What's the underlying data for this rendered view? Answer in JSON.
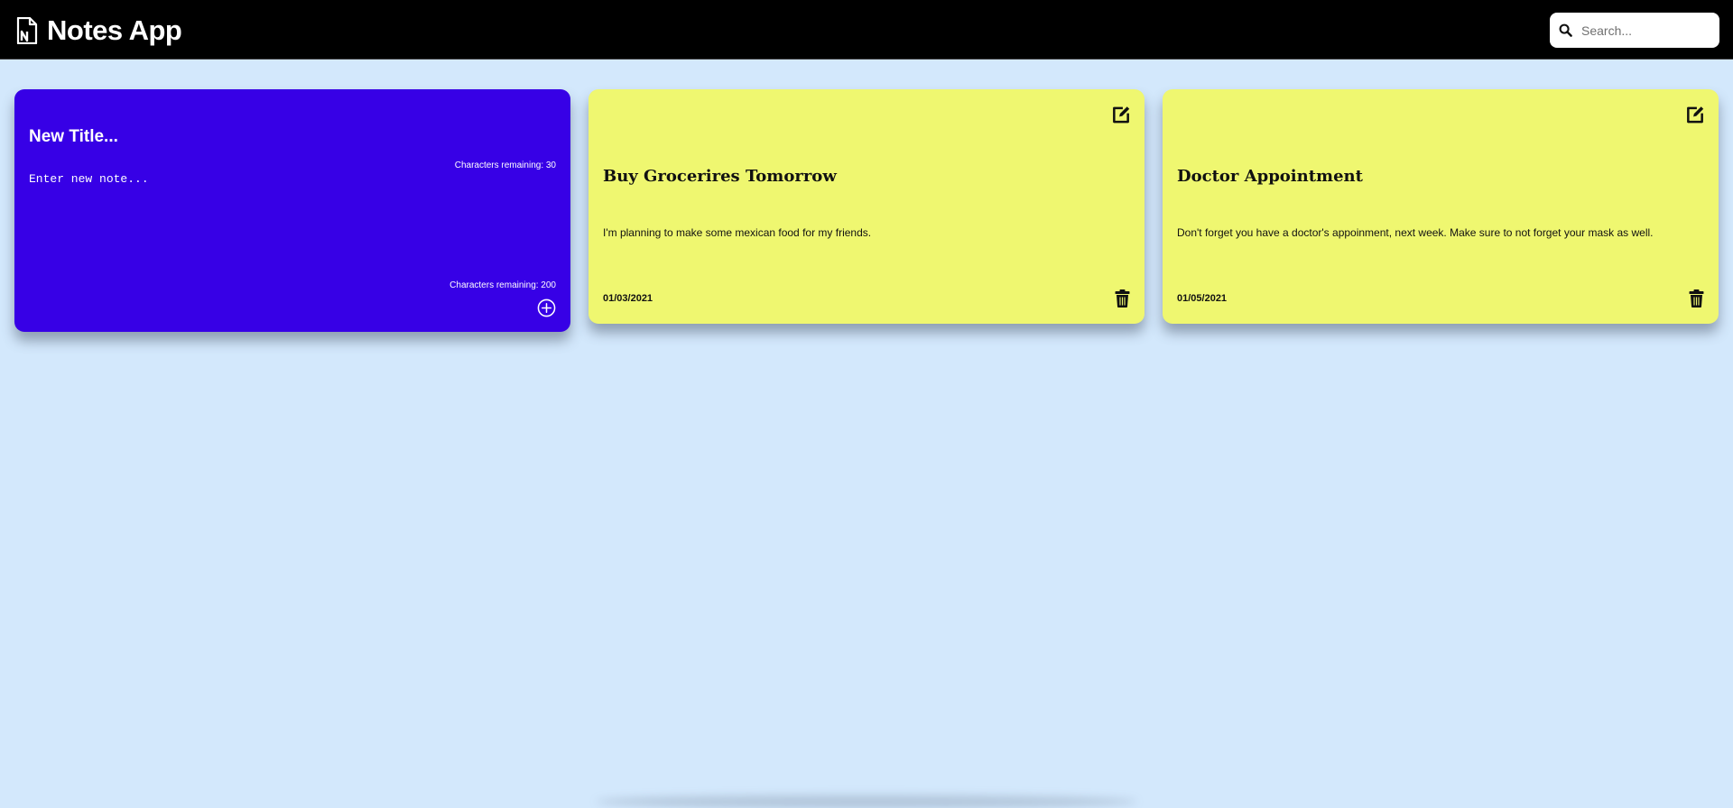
{
  "header": {
    "app_title": "Notes App",
    "logo_icon": "note-document-icon",
    "search": {
      "placeholder": "Search...",
      "value": "",
      "icon": "search-icon"
    }
  },
  "new_note": {
    "title_placeholder": "New Title...",
    "title_chars_remaining": "Characters remaining: 30",
    "body_placeholder": "Enter new note...",
    "body_chars_remaining": "Characters remaining: 200",
    "add_icon": "plus-circle-icon",
    "color": "#3700e6"
  },
  "notes": [
    {
      "title": "Buy Grocerires Tomorrow",
      "text": "I'm planning to make some mexican food for my friends.",
      "date": "01/03/2021",
      "edit_icon": "edit-icon",
      "delete_icon": "trash-icon",
      "color": "#eff770"
    },
    {
      "title": "Doctor Appointment",
      "text": "Don't forget you have a doctor's appoinment, next week. Make sure to not forget your mask as well.",
      "date": "01/05/2021",
      "edit_icon": "edit-icon",
      "delete_icon": "trash-icon",
      "color": "#eff770"
    }
  ],
  "colors": {
    "background": "#d3e8fc",
    "header": "#000000"
  }
}
